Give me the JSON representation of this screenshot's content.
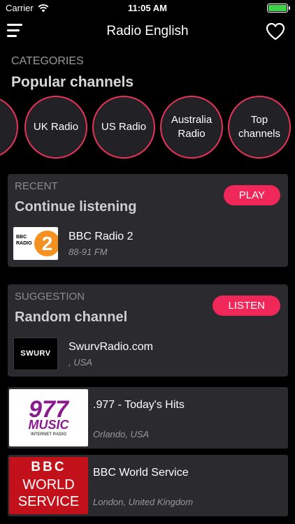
{
  "status": {
    "carrier": "Carrier",
    "time": "11:05 AM"
  },
  "nav": {
    "title": "Radio English",
    "menu_icon": "hamburger-menu-icon",
    "favorite_icon": "heart-icon"
  },
  "categories": {
    "label": "CATEGORIES",
    "title": "Popular channels",
    "items": [
      {
        "label": ""
      },
      {
        "label": "UK Radio"
      },
      {
        "label": "US Radio"
      },
      {
        "label": "Australia Radio"
      },
      {
        "label": "Top channels"
      }
    ]
  },
  "recent": {
    "kicker": "RECENT",
    "title": "Continue listening",
    "action": "PLAY",
    "station": {
      "name": "BBC Radio 2",
      "sub": "88-91 FM",
      "logo_text": "BBC RADIO",
      "logo_number": "2"
    }
  },
  "suggestion": {
    "kicker": "SUGGESTION",
    "title": "Random channel",
    "action": "LISTEN",
    "station": {
      "name": "SwurvRadio.com",
      "sub": ", USA",
      "logo_text": "SWURV"
    }
  },
  "list": [
    {
      "name": ".977 - Today's Hits",
      "sub": "Orlando, USA",
      "logo_top": "977",
      "logo_mid": "MUSIC",
      "logo_bottom": "INTERNET RADIO"
    },
    {
      "name": "BBC World Service",
      "sub": "London, United Kingdom",
      "logo_top": "BBC",
      "logo_mid": "WORLD",
      "logo_bottom": "SERVICE"
    }
  ],
  "colors": {
    "accent": "#f0285a",
    "circle_border": "#e8325a",
    "card_bg": "#2a2a2f",
    "background": "#000000"
  }
}
